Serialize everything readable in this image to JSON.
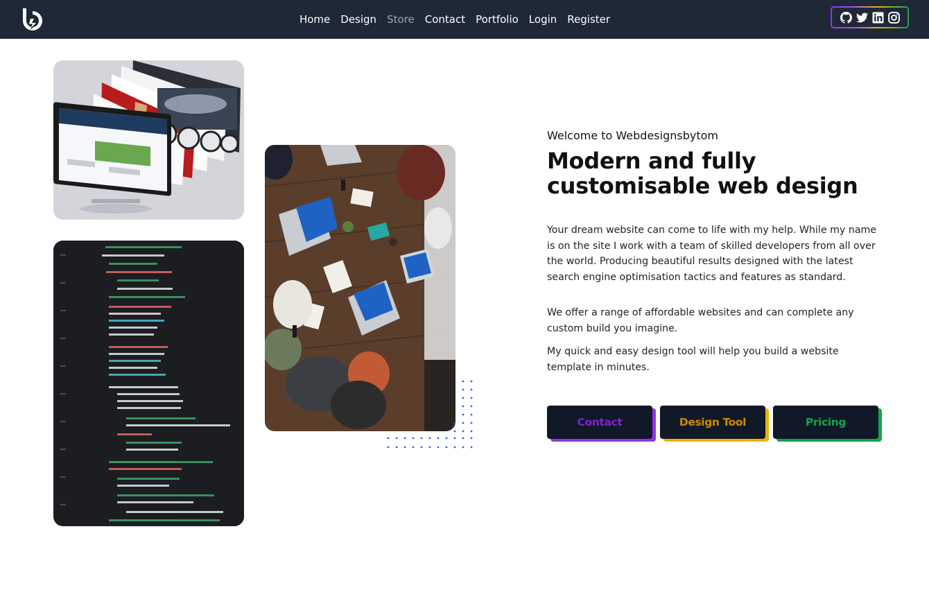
{
  "nav": {
    "links": [
      "Home",
      "Design",
      "Store",
      "Contact",
      "Portfolio",
      "Login",
      "Register"
    ],
    "active": "Store",
    "social": [
      "github-icon",
      "twitter-icon",
      "linkedin-icon",
      "instagram-icon"
    ]
  },
  "hero": {
    "welcome": "Welcome to Webdesignsbytom",
    "headline": "Modern and fully customisable web design",
    "paragraphs": [
      "Your dream website can come to life with my help. While my name is on the site I work with a team of skilled developers from all over the world. Producing beautiful results designed with the latest search engine optimisation tactics and features as standard.",
      "We offer a range of affordable websites and can complete any custom build you imagine.",
      "My quick and easy design tool will help you build a website template in minutes."
    ],
    "buttons": {
      "contact": "Contact",
      "design_tool": "Design Tool",
      "pricing": "Pricing"
    }
  },
  "colors": {
    "navbar": "#1f2837",
    "button_bg": "#111827",
    "contact_accent": "#9333ea",
    "design_accent": "#eab308",
    "pricing_accent": "#16a34a",
    "dots": "#2563eb"
  }
}
